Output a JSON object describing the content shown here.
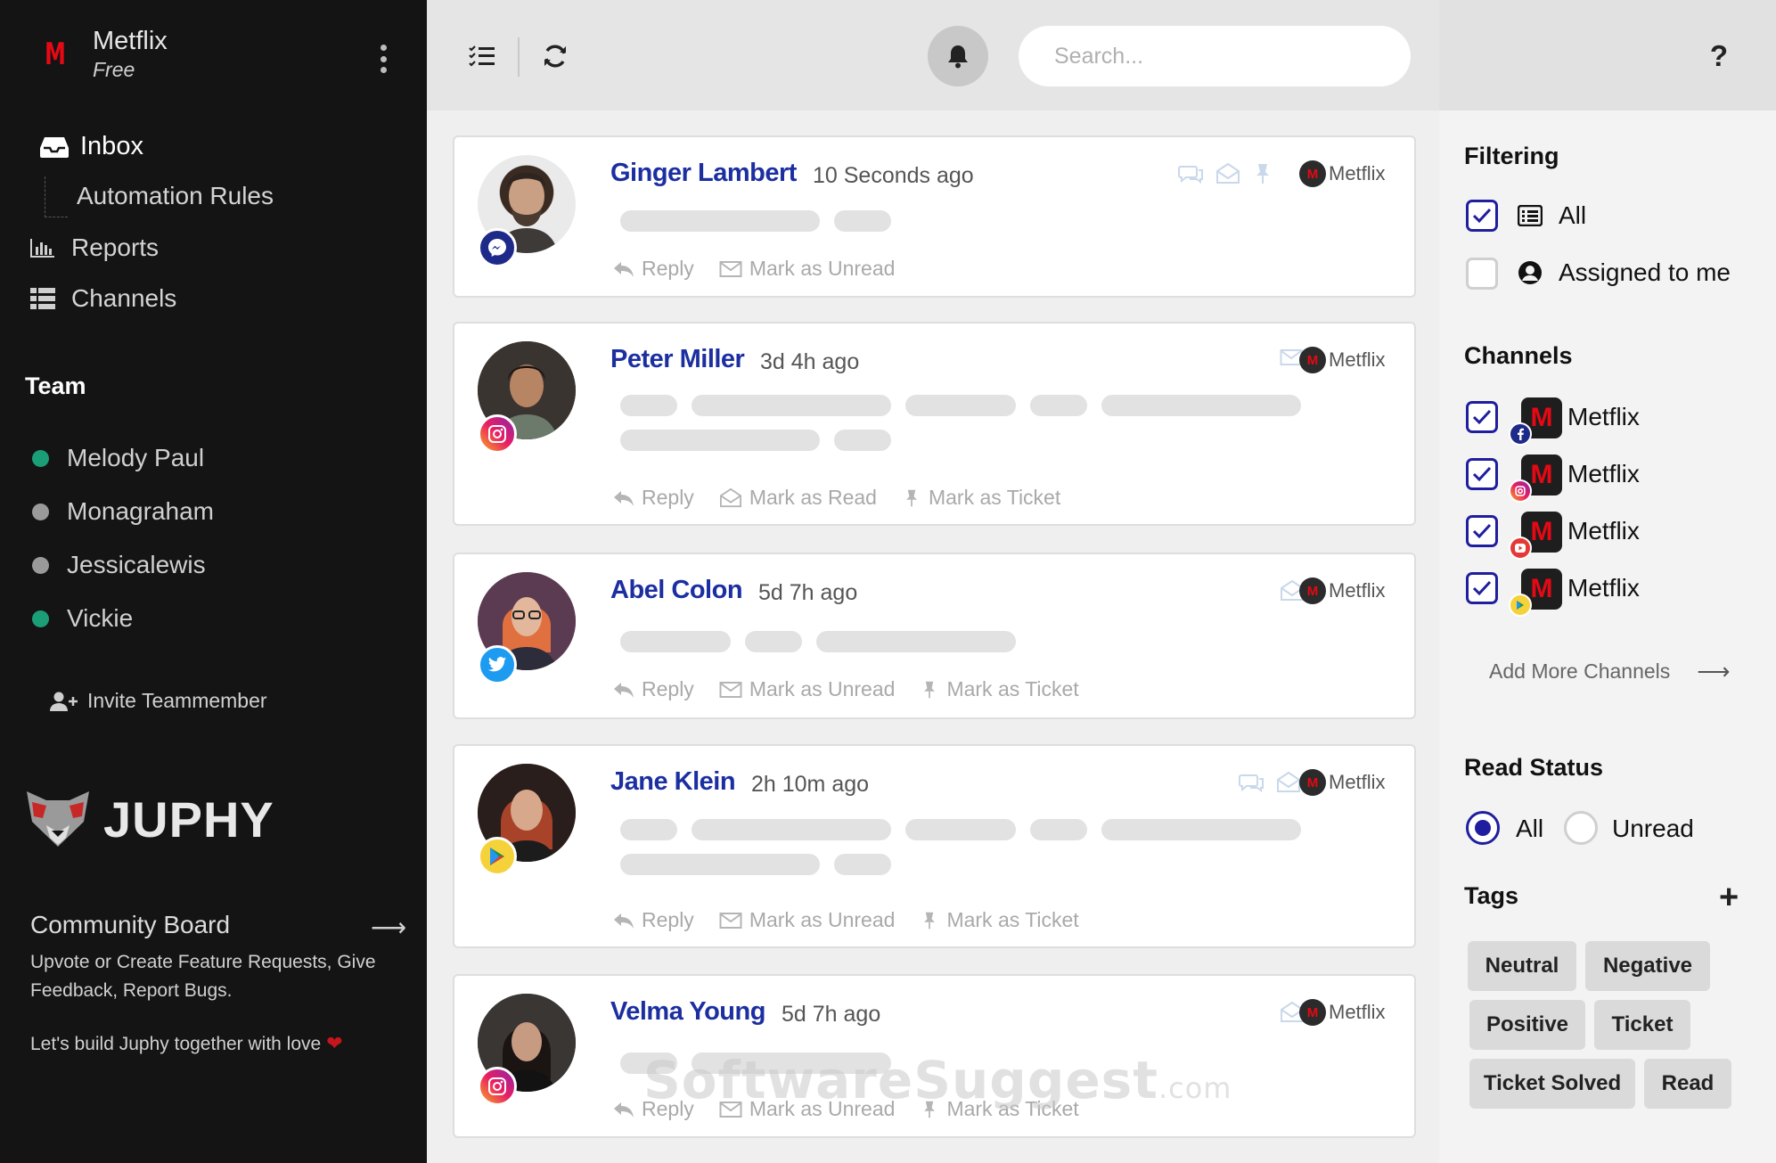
{
  "sidebar": {
    "brand_name": "Metflix",
    "brand_plan": "Free",
    "brand_letter": "M",
    "nav": {
      "inbox": "Inbox",
      "automation": "Automation Rules",
      "reports": "Reports",
      "channels": "Channels"
    },
    "team_heading": "Team",
    "team": [
      {
        "name": "Melody Paul",
        "status_color": "#1b9e77"
      },
      {
        "name": "Monagraham",
        "status_color": "#9a9a9a"
      },
      {
        "name": "Jessicalewis",
        "status_color": "#9a9a9a"
      },
      {
        "name": "Vickie",
        "status_color": "#1b9e77"
      }
    ],
    "invite_label": "Invite Teammember",
    "logo_word": "JUPHY",
    "community": {
      "title": "Community Board",
      "arrow": "⟶",
      "description": "Upvote or Create Feature Requests, Give Feedback, Report Bugs.",
      "love_line": "Let's build Juphy together with love",
      "heart": "❤"
    }
  },
  "topbar": {
    "search_placeholder": "Search...",
    "icons": [
      "tasks-icon",
      "refresh-icon",
      "bell-icon"
    ]
  },
  "messages": [
    {
      "name": "Ginger Lambert",
      "time": "10 Seconds ago",
      "channel": "messenger",
      "account": "Metflix",
      "status_icons": [
        "chat-icon",
        "envelope-open-icon",
        "pin-icon"
      ],
      "actions": [
        "Reply",
        "Mark as Unread"
      ]
    },
    {
      "name": "Peter Miller",
      "time": "3d 4h ago",
      "channel": "instagram",
      "account": "Metflix",
      "status_icons": [
        "envelope-icon"
      ],
      "actions": [
        "Reply",
        "Mark as Read",
        "Mark as Ticket"
      ]
    },
    {
      "name": "Abel Colon",
      "time": "5d 7h ago",
      "channel": "twitter",
      "account": "Metflix",
      "status_icons": [
        "envelope-open-icon"
      ],
      "actions": [
        "Reply",
        "Mark as Unread",
        "Mark as Ticket"
      ]
    },
    {
      "name": "Jane Klein",
      "time": "2h 10m ago",
      "channel": "google-play",
      "account": "Metflix",
      "status_icons": [
        "chat-icon",
        "envelope-open-icon"
      ],
      "actions": [
        "Reply",
        "Mark as Unread",
        "Mark as Ticket"
      ]
    },
    {
      "name": "Velma Young",
      "time": "5d 7h ago",
      "channel": "instagram",
      "account": "Metflix",
      "status_icons": [
        "envelope-open-icon"
      ],
      "actions": [
        "Reply",
        "Mark as Unread",
        "Mark as Ticket"
      ]
    }
  ],
  "watermark": {
    "main": "SoftwareSuggest",
    "suffix": ".com"
  },
  "right_panel": {
    "help": "?",
    "filtering_heading": "Filtering",
    "filters": [
      {
        "label": "All",
        "checked": true
      },
      {
        "label": "Assigned to me",
        "checked": false
      }
    ],
    "channels_heading": "Channels",
    "channels": [
      {
        "name": "Metflix",
        "network": "facebook",
        "checked": true
      },
      {
        "name": "Metflix",
        "network": "instagram",
        "checked": true
      },
      {
        "name": "Metflix",
        "network": "youtube",
        "checked": true
      },
      {
        "name": "Metflix",
        "network": "google-play",
        "checked": true
      }
    ],
    "add_more": "Add More Channels",
    "read_status_heading": "Read Status",
    "read_status": [
      {
        "label": "All",
        "selected": true
      },
      {
        "label": "Unread",
        "selected": false
      }
    ],
    "tags_heading": "Tags",
    "tags": [
      "Neutral",
      "Negative",
      "Positive",
      "Ticket",
      "Ticket Solved",
      "Read"
    ]
  },
  "colors": {
    "sidebar_bg": "#141414",
    "accent_blue": "#1f1e9e",
    "name_blue": "#1c2fa0",
    "brand_red": "#e50914"
  }
}
